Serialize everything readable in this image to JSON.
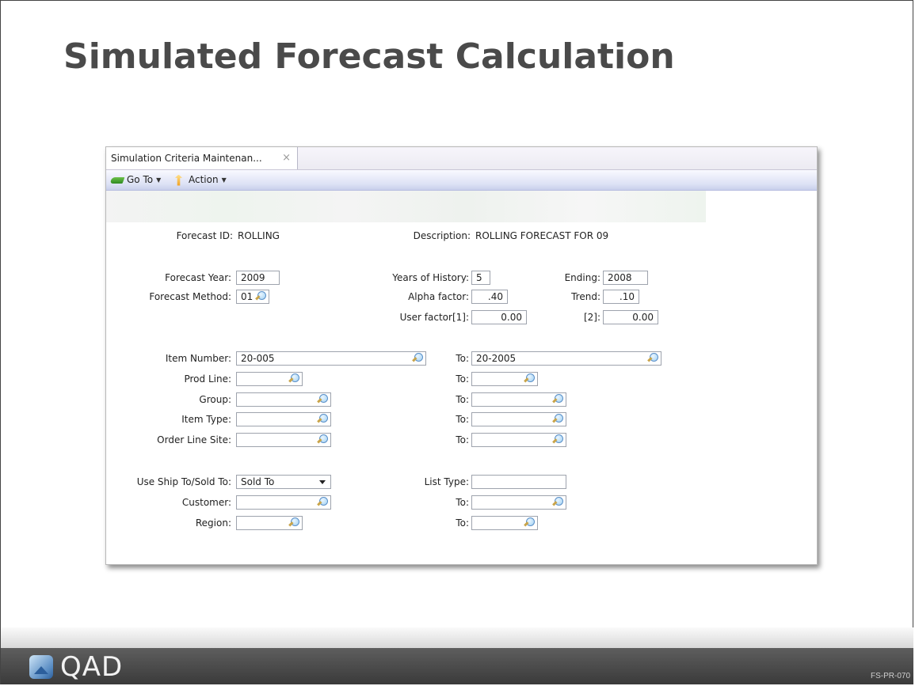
{
  "slide": {
    "title": "Simulated Forecast Calculation",
    "logo_text": "QAD",
    "code": "FS-PR-070"
  },
  "window": {
    "tab_label": "Simulation Criteria Maintenan...",
    "tab_close": "×",
    "toolbar": {
      "goto_label": "Go To",
      "action_label": "Action"
    }
  },
  "form": {
    "forecast_id": {
      "label": "Forecast ID:",
      "value": "ROLLING"
    },
    "description": {
      "label": "Description:",
      "value": "ROLLING FORECAST FOR 09"
    },
    "forecast_year": {
      "label": "Forecast Year:",
      "value": "2009"
    },
    "years_of_history": {
      "label": "Years of History:",
      "value": "5"
    },
    "ending": {
      "label": "Ending:",
      "value": "2008"
    },
    "forecast_method": {
      "label": "Forecast Method:",
      "value": "01"
    },
    "alpha_factor": {
      "label": "Alpha factor:",
      "value": ".40"
    },
    "trend": {
      "label": "Trend:",
      "value": ".10"
    },
    "user_factor_1": {
      "label": "User factor[1]:",
      "value": "0.00"
    },
    "user_factor_2": {
      "label": "[2]:",
      "value": "0.00"
    },
    "item_number": {
      "label": "Item Number:",
      "value": "20-005",
      "to_label": "To:",
      "to_value": "20-2005"
    },
    "prod_line": {
      "label": "Prod Line:",
      "value": "",
      "to_label": "To:",
      "to_value": ""
    },
    "group": {
      "label": "Group:",
      "value": "",
      "to_label": "To:",
      "to_value": ""
    },
    "item_type": {
      "label": "Item Type:",
      "value": "",
      "to_label": "To:",
      "to_value": ""
    },
    "order_line_site": {
      "label": "Order Line Site:",
      "value": "",
      "to_label": "To:",
      "to_value": ""
    },
    "use_ship_sold": {
      "label": "Use Ship To/Sold To:",
      "value": "Sold To"
    },
    "list_type": {
      "label": "List Type:",
      "value": ""
    },
    "customer": {
      "label": "Customer:",
      "value": "",
      "to_label": "To:",
      "to_value": ""
    },
    "region": {
      "label": "Region:",
      "value": "",
      "to_label": "To:",
      "to_value": ""
    }
  },
  "colors": {
    "title": "#4a4a4a",
    "toolbar_accent": "#c8cfeb",
    "footer": "#3a3a3a"
  }
}
